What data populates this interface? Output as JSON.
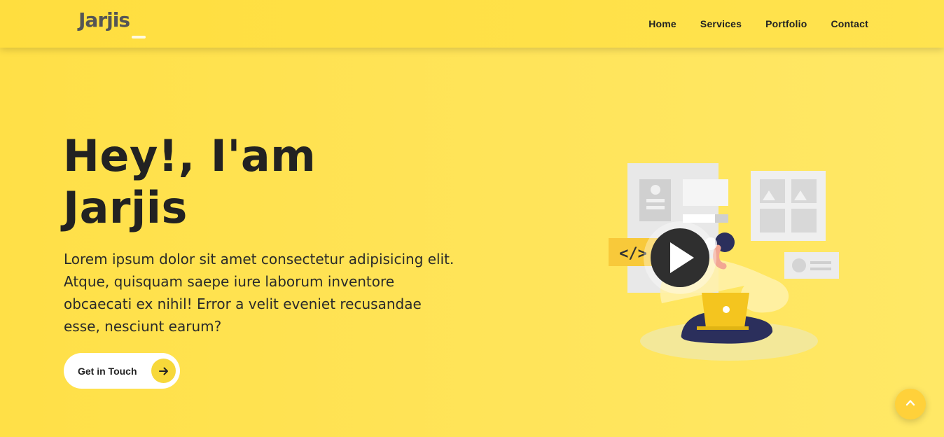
{
  "header": {
    "logo_text": "Jarjis",
    "nav": [
      {
        "label": "Home"
      },
      {
        "label": "Services"
      },
      {
        "label": "Portfolio"
      },
      {
        "label": "Contact"
      }
    ]
  },
  "hero": {
    "title_line1": "Hey!, I'am",
    "title_line2": "Jarjis",
    "description": "Lorem ipsum dolor sit amet consectetur adipisicing elit. Atque, quisquam saepe iure laborum inventore obcaecati ex nihil! Error a velit eveniet recusandae esse, nesciunt earum?",
    "cta_label": "Get in Touch",
    "code_tag": "</>"
  },
  "icons": {
    "cta_arrow": "arrow-right-icon",
    "scroll_top": "chevron-up-icon",
    "play": "play-icon"
  },
  "colors": {
    "background": "#ffe047",
    "accent": "#f7d83a",
    "text": "#222222"
  }
}
